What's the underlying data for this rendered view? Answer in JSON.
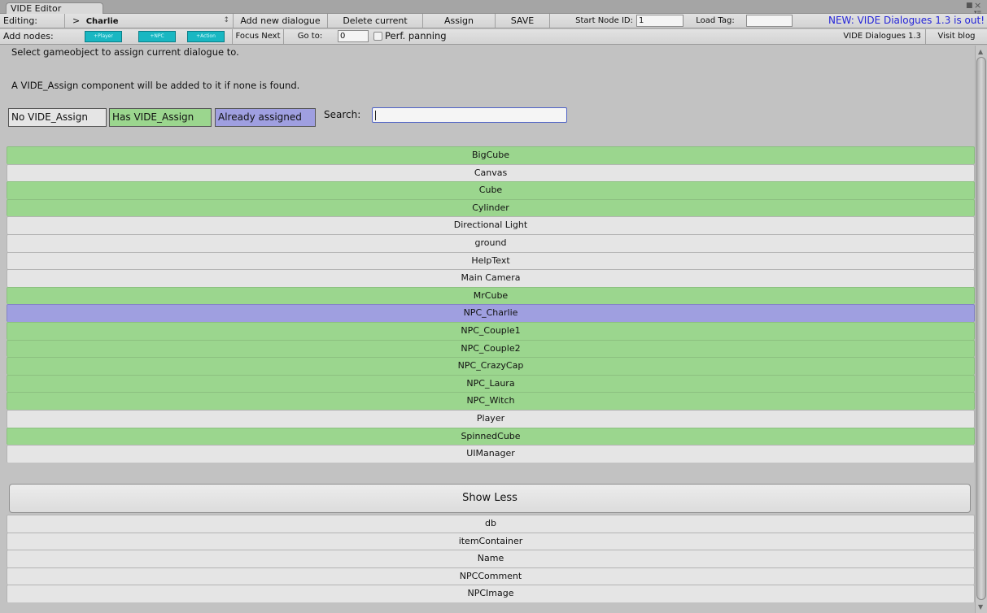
{
  "window": {
    "tab_title": "VIDE Editor"
  },
  "toolbar": {
    "editing_label": "Editing:",
    "editing_arrow": ">",
    "editing_value": "Charlie",
    "dropdown_glyph": "↕",
    "add_dialogue": "Add new dialogue",
    "delete_current": "Delete current",
    "assign": "Assign",
    "save": "SAVE",
    "start_node_label": "Start Node ID:",
    "start_node_value": "1",
    "load_tag_label": "Load Tag:",
    "load_tag_value": "",
    "news": "NEW: VIDE Dialogues 1.3 is out!"
  },
  "toolbar2": {
    "add_nodes_label": "Add nodes:",
    "node_buttons": [
      "+Player",
      "+NPC",
      "+Action"
    ],
    "focus_next": "Focus Next",
    "goto_label": "Go to:",
    "goto_value": "0",
    "perf_panning": "Perf. panning",
    "version": "VIDE Dialogues 1.3",
    "visit_blog": "Visit blog"
  },
  "panel": {
    "line1": "Select gameobject to assign current dialogue to.",
    "line2": "A VIDE_Assign component will be added to it if none is found.",
    "legend_none": "No VIDE_Assign",
    "legend_has": "Has VIDE_Assign",
    "legend_assigned": "Already assigned",
    "search_label": "Search:",
    "search_value": "",
    "show_less": "Show Less"
  },
  "colors": {
    "has_assign": "#9bd68e",
    "no_assign": "#e5e5e5",
    "already_assigned": "#9f9fe0",
    "node_button": "#19b7c2",
    "news_link": "#2424d8"
  },
  "objects": [
    {
      "name": "BigCube",
      "state": "has"
    },
    {
      "name": "Canvas",
      "state": "none"
    },
    {
      "name": "Cube",
      "state": "has"
    },
    {
      "name": "Cylinder",
      "state": "has"
    },
    {
      "name": "Directional Light",
      "state": "none"
    },
    {
      "name": "ground",
      "state": "none"
    },
    {
      "name": "HelpText",
      "state": "none"
    },
    {
      "name": "Main Camera",
      "state": "none"
    },
    {
      "name": "MrCube",
      "state": "has"
    },
    {
      "name": "NPC_Charlie",
      "state": "assigned"
    },
    {
      "name": "NPC_Couple1",
      "state": "has"
    },
    {
      "name": "NPC_Couple2",
      "state": "has"
    },
    {
      "name": "NPC_CrazyCap",
      "state": "has"
    },
    {
      "name": "NPC_Laura",
      "state": "has"
    },
    {
      "name": "NPC_Witch",
      "state": "has"
    },
    {
      "name": "Player",
      "state": "none"
    },
    {
      "name": "SpinnedCube",
      "state": "has"
    },
    {
      "name": "UIManager",
      "state": "none"
    }
  ],
  "more_objects": [
    {
      "name": "db",
      "state": "none"
    },
    {
      "name": "itemContainer",
      "state": "none"
    },
    {
      "name": "Name",
      "state": "none"
    },
    {
      "name": "NPCComment",
      "state": "none"
    },
    {
      "name": "NPCImage",
      "state": "none"
    }
  ]
}
